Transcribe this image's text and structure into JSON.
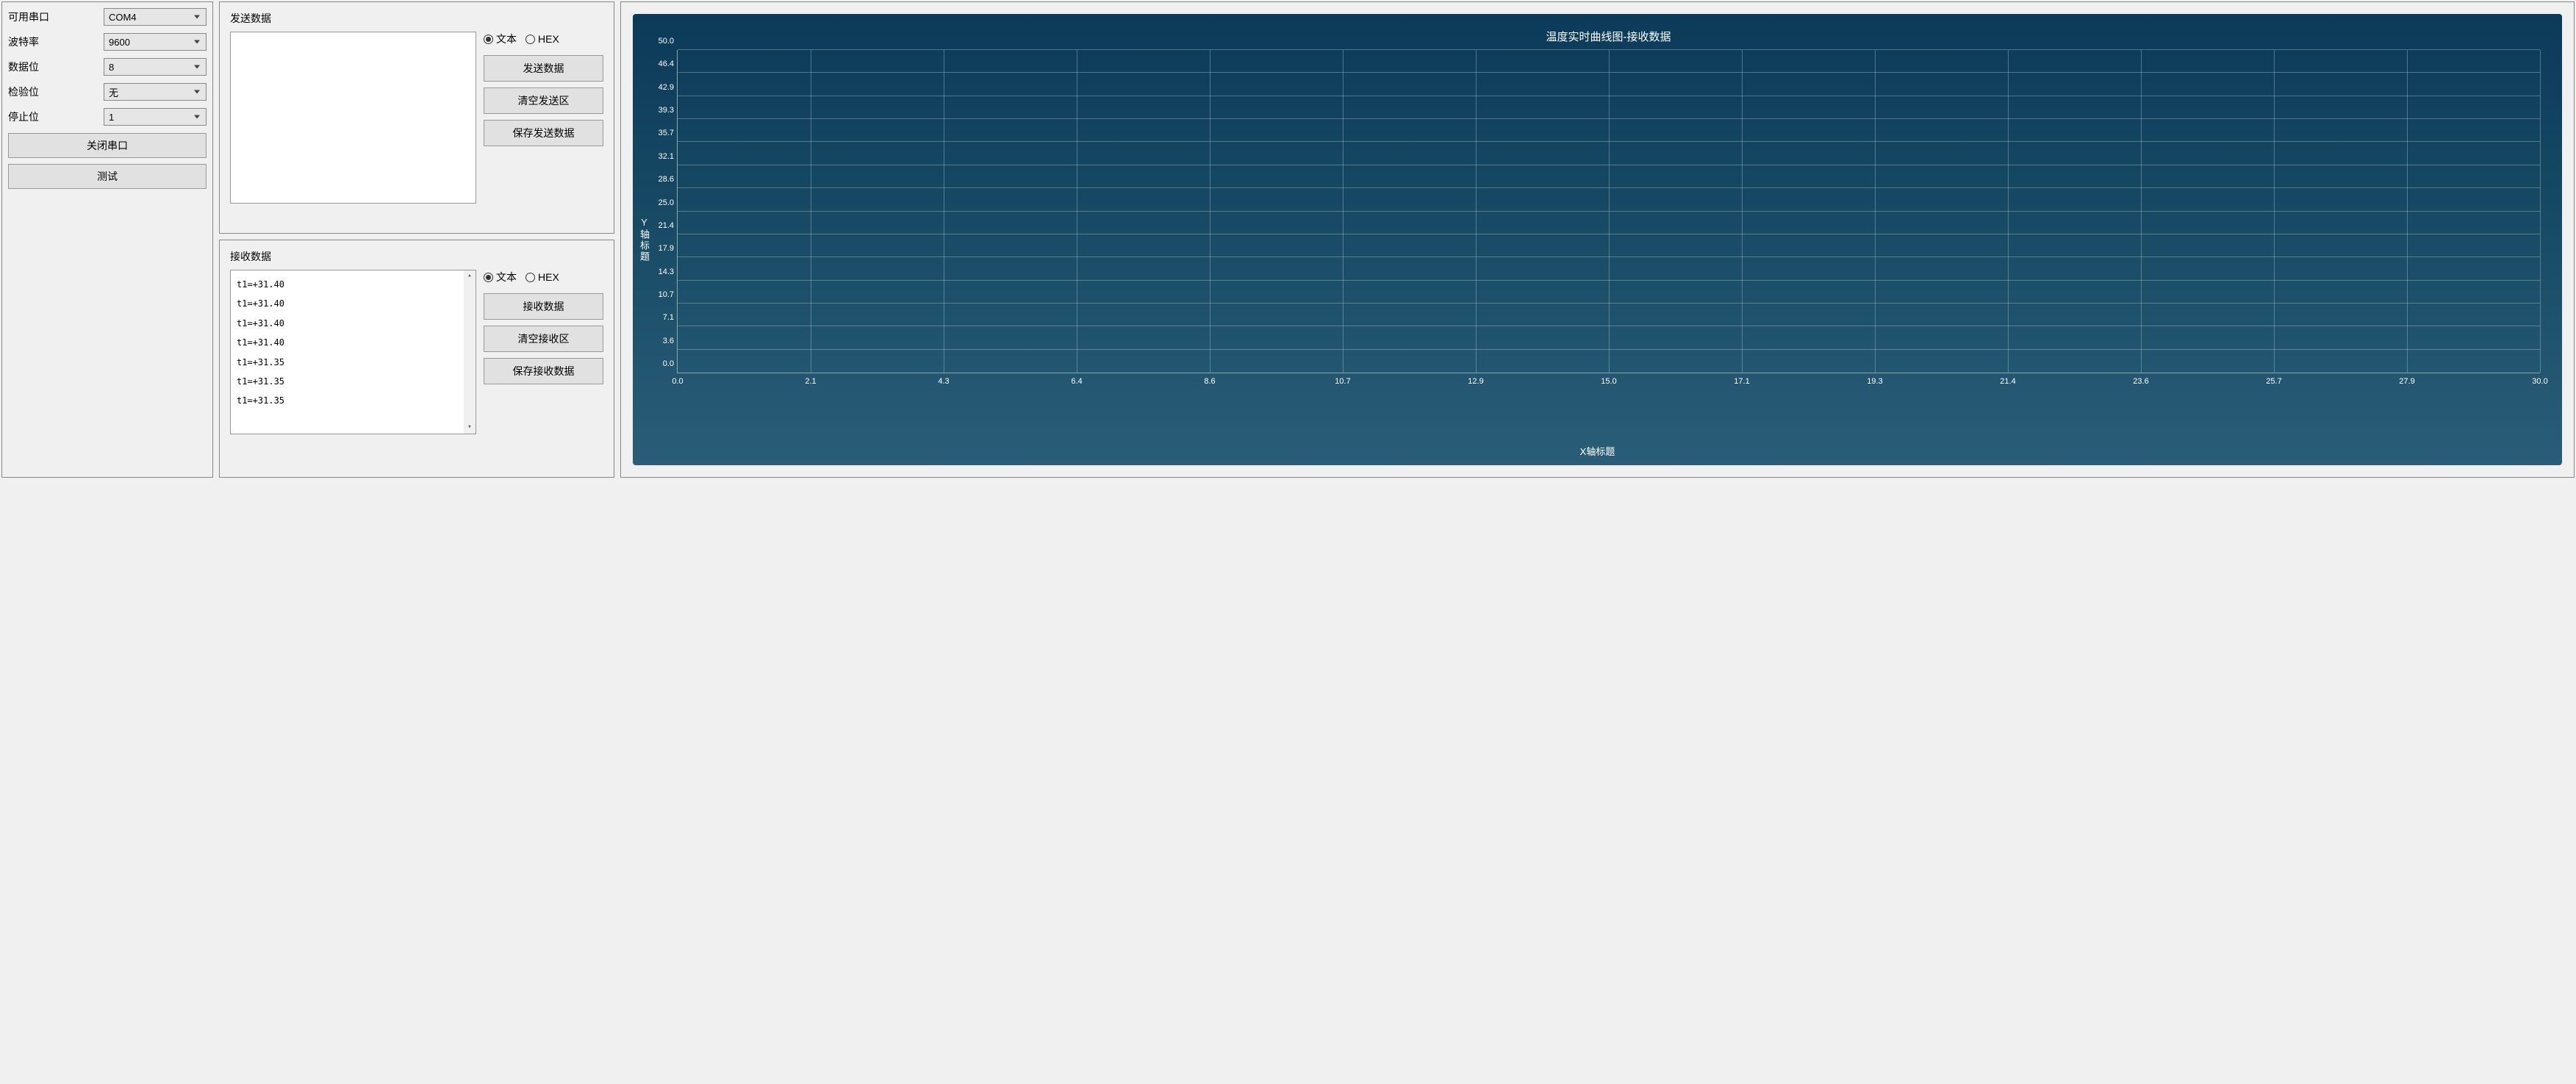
{
  "config": {
    "port_label": "可用串口",
    "port_value": "COM4",
    "baud_label": "波特率",
    "baud_value": "9600",
    "databits_label": "数据位",
    "databits_value": "8",
    "parity_label": "检验位",
    "parity_value": "无",
    "stopbits_label": "停止位",
    "stopbits_value": "1",
    "close_port_btn": "关闭串口",
    "test_btn": "测试"
  },
  "send": {
    "title": "发送数据",
    "text_radio": "文本",
    "hex_radio": "HEX",
    "send_btn": "发送数据",
    "clear_btn": "清空发送区",
    "save_btn": "保存发送数据",
    "content": ""
  },
  "recv": {
    "title": "接收数据",
    "text_radio": "文本",
    "hex_radio": "HEX",
    "recv_btn": "接收数据",
    "clear_btn": "清空接收区",
    "save_btn": "保存接收数据",
    "lines": [
      "t1=+31.40",
      "t1=+31.40",
      "t1=+31.40",
      "t1=+31.40",
      "t1=+31.35",
      "t1=+31.35",
      "t1=+31.35"
    ]
  },
  "chart_data": {
    "type": "line",
    "title": "温度实时曲线图-接收数据",
    "xlabel": "X轴标题",
    "ylabel": "Y轴标题",
    "xlim": [
      0.0,
      30.0
    ],
    "ylim": [
      0.0,
      50.0
    ],
    "x_ticks": [
      "0.0",
      "2.1",
      "4.3",
      "6.4",
      "8.6",
      "10.7",
      "12.9",
      "15.0",
      "17.1",
      "19.3",
      "21.4",
      "23.6",
      "25.7",
      "27.9",
      "30.0"
    ],
    "y_ticks": [
      "0.0",
      "3.6",
      "7.1",
      "10.7",
      "14.3",
      "17.9",
      "21.4",
      "25.0",
      "28.6",
      "32.1",
      "35.7",
      "39.3",
      "42.9",
      "46.4",
      "50.0"
    ],
    "series": []
  }
}
